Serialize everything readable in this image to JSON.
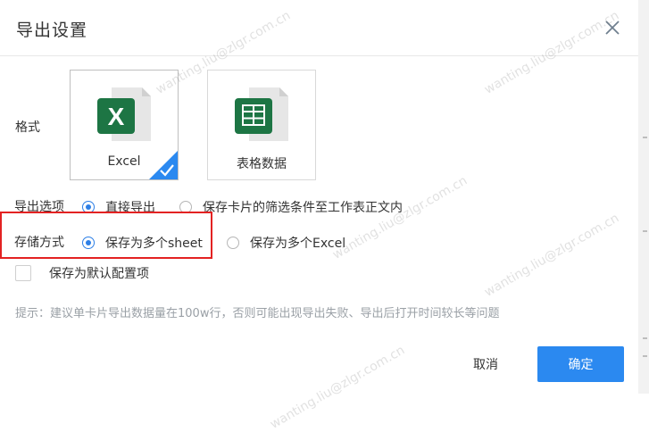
{
  "dialog": {
    "title": "导出设置",
    "close_icon": "close-icon"
  },
  "format": {
    "label": "格式",
    "options": [
      {
        "label": "Excel",
        "icon": "excel-icon",
        "selected": true
      },
      {
        "label": "表格数据",
        "icon": "table-data-icon",
        "selected": false
      }
    ]
  },
  "export_option": {
    "label": "导出选项",
    "options": [
      {
        "label": "直接导出",
        "selected": true
      },
      {
        "label": "保存卡片的筛选条件至工作表正文内",
        "selected": false
      }
    ]
  },
  "storage": {
    "label": "存储方式",
    "options": [
      {
        "label": "保存为多个sheet",
        "selected": true
      },
      {
        "label": "保存为多个Excel",
        "selected": false
      }
    ]
  },
  "default_config": {
    "label": "保存为默认配置项",
    "checked": false
  },
  "hint": "提示：建议单卡片导出数据量在100w行，否则可能出现导出失败、导出后打开时间较长等问题",
  "buttons": {
    "cancel": "取消",
    "ok": "确定"
  },
  "watermark": "wanting.liu@zlgr.com.cn",
  "colors": {
    "primary": "#2b89f0",
    "excel_green": "#1d7544",
    "highlight_red": "#e32222"
  }
}
